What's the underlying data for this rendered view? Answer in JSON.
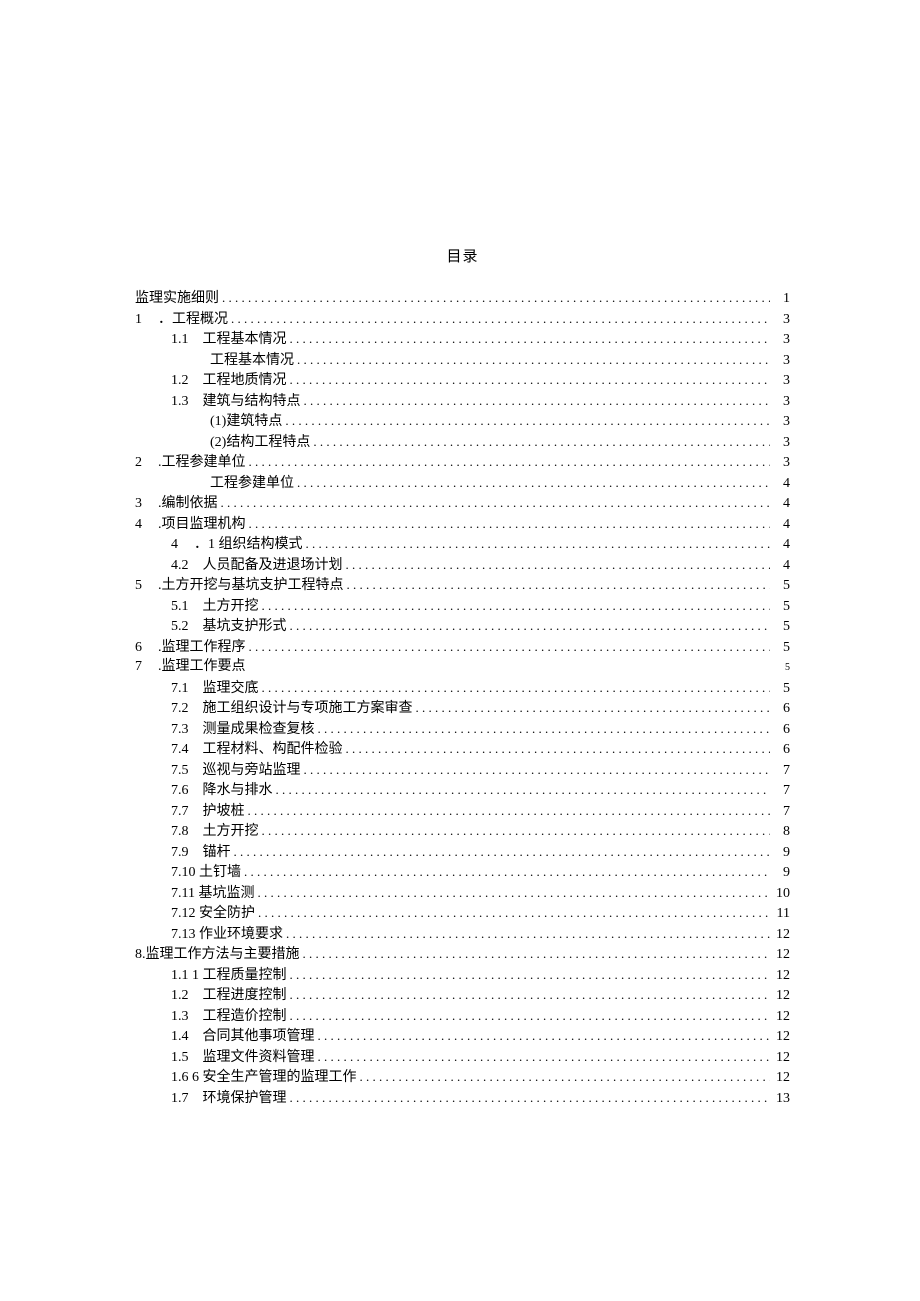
{
  "title": "目录",
  "entries": [
    {
      "indent": "indent-0",
      "num": "",
      "label": "监理实施细则",
      "gap": "",
      "page": "1",
      "pageSmall": false,
      "dots": true
    },
    {
      "indent": "indent-top",
      "num": "1",
      "label": "．工程概况",
      "gap": "gap-1",
      "page": "3",
      "pageSmall": false,
      "dots": true
    },
    {
      "indent": "indent-sec",
      "num": "1.1",
      "label": "工程基本情况",
      "gap": "gap-2",
      "page": "3",
      "pageSmall": false,
      "dots": true
    },
    {
      "indent": "indent-sub",
      "num": "",
      "label": "工程基本情况",
      "gap": "",
      "page": "3",
      "pageSmall": false,
      "dots": true
    },
    {
      "indent": "indent-sec",
      "num": "1.2",
      "label": "工程地质情况",
      "gap": "gap-2",
      "page": "3",
      "pageSmall": false,
      "dots": true
    },
    {
      "indent": "indent-sec",
      "num": "1.3",
      "label": "建筑与结构特点",
      "gap": "gap-2",
      "page": "3",
      "pageSmall": false,
      "dots": true
    },
    {
      "indent": "indent-sub",
      "num": "",
      "label": "(1)建筑特点",
      "gap": "",
      "page": "3",
      "pageSmall": false,
      "dots": true
    },
    {
      "indent": "indent-sub",
      "num": "",
      "label": "(2)结构工程特点",
      "gap": "",
      "page": "3",
      "pageSmall": false,
      "dots": true
    },
    {
      "indent": "indent-top",
      "num": "2",
      "label": ".工程参建单位",
      "gap": "gap-1",
      "page": "3",
      "pageSmall": false,
      "dots": true
    },
    {
      "indent": "indent-sub",
      "num": "",
      "label": "工程参建单位",
      "gap": "",
      "page": "4",
      "pageSmall": false,
      "dots": true
    },
    {
      "indent": "indent-top",
      "num": "3",
      "label": ".编制依据",
      "gap": "gap-1",
      "page": "4",
      "pageSmall": false,
      "dots": true
    },
    {
      "indent": "indent-top",
      "num": "4",
      "label": ".项目监理机构",
      "gap": "gap-1",
      "page": "4",
      "pageSmall": false,
      "dots": true
    },
    {
      "indent": "indent-sec",
      "num": "4",
      "label": "．1 组织结构模式",
      "gap": "gap-1",
      "page": "4",
      "pageSmall": false,
      "dots": true
    },
    {
      "indent": "indent-sec",
      "num": "4.2",
      "label": "人员配备及进退场计划",
      "gap": "gap-2",
      "page": "4",
      "pageSmall": false,
      "dots": true
    },
    {
      "indent": "indent-top",
      "num": "5",
      "label": ".土方开挖与基坑支护工程特点",
      "gap": "gap-1",
      "page": "5",
      "pageSmall": false,
      "dots": true
    },
    {
      "indent": "indent-sec",
      "num": "5.1",
      "label": "土方开挖",
      "gap": "gap-2",
      "page": "5",
      "pageSmall": false,
      "dots": true
    },
    {
      "indent": "indent-sec",
      "num": "5.2",
      "label": "基坑支护形式",
      "gap": "gap-2",
      "page": "5",
      "pageSmall": false,
      "dots": true
    },
    {
      "indent": "indent-top",
      "num": "6",
      "label": ".监理工作程序",
      "gap": "gap-1",
      "page": "5",
      "pageSmall": false,
      "dots": true
    },
    {
      "indent": "indent-top",
      "num": "7",
      "label": ".监理工作要点",
      "gap": "gap-1",
      "page": "5",
      "pageSmall": true,
      "dots": false
    },
    {
      "indent": "indent-sec",
      "num": "7.1",
      "label": "监理交底",
      "gap": "gap-2",
      "page": "5",
      "pageSmall": false,
      "dots": true
    },
    {
      "indent": "indent-sec",
      "num": "7.2",
      "label": "施工组织设计与专项施工方案审查",
      "gap": "gap-2",
      "page": "6",
      "pageSmall": false,
      "dots": true
    },
    {
      "indent": "indent-sec",
      "num": "7.3",
      "label": "测量成果检查复核",
      "gap": "gap-2",
      "page": "6",
      "pageSmall": false,
      "dots": true
    },
    {
      "indent": "indent-sec",
      "num": "7.4",
      "label": "工程材料、构配件检验",
      "gap": "gap-2",
      "page": "6",
      "pageSmall": false,
      "dots": true
    },
    {
      "indent": "indent-sec",
      "num": "7.5",
      "label": "巡视与旁站监理",
      "gap": "gap-2",
      "page": "7",
      "pageSmall": false,
      "dots": true
    },
    {
      "indent": "indent-sec",
      "num": "7.6",
      "label": "降水与排水",
      "gap": "gap-2",
      "page": "7",
      "pageSmall": false,
      "dots": true
    },
    {
      "indent": "indent-sec",
      "num": "7.7",
      "label": "护坡桩",
      "gap": "gap-2",
      "page": "7",
      "pageSmall": false,
      "dots": true
    },
    {
      "indent": "indent-sec",
      "num": "7.8",
      "label": "土方开挖",
      "gap": "gap-2",
      "page": "8",
      "pageSmall": false,
      "dots": true
    },
    {
      "indent": "indent-sec",
      "num": "7.9",
      "label": "锚杆",
      "gap": "gap-2",
      "page": "9",
      "pageSmall": false,
      "dots": true
    },
    {
      "indent": "indent-sec",
      "num": "",
      "label": "7.10 土钉墙",
      "gap": "",
      "page": "9",
      "pageSmall": false,
      "dots": true
    },
    {
      "indent": "indent-sec",
      "num": "",
      "label": "7.11 基坑监测",
      "gap": "",
      "page": "10",
      "pageSmall": false,
      "dots": true
    },
    {
      "indent": "indent-sec",
      "num": "",
      "label": "7.12 安全防护",
      "gap": "",
      "page": "11",
      "pageSmall": false,
      "dots": true
    },
    {
      "indent": "indent-sec",
      "num": "",
      "label": "7.13 作业环境要求",
      "gap": "",
      "page": "12",
      "pageSmall": false,
      "dots": true
    },
    {
      "indent": "indent-0",
      "num": "",
      "label": "8.监理工作方法与主要措施",
      "gap": "",
      "page": "12",
      "pageSmall": false,
      "dots": true
    },
    {
      "indent": "indent-sec",
      "num": "",
      "label": "1.1 1 工程质量控制",
      "gap": "",
      "page": "12",
      "pageSmall": false,
      "dots": true
    },
    {
      "indent": "indent-sec",
      "num": "1.2",
      "label": "工程进度控制",
      "gap": "gap-2",
      "page": "12",
      "pageSmall": false,
      "dots": true
    },
    {
      "indent": "indent-sec",
      "num": "1.3",
      "label": "工程造价控制",
      "gap": "gap-2",
      "page": "12",
      "pageSmall": false,
      "dots": true
    },
    {
      "indent": "indent-sec",
      "num": "1.4",
      "label": "合同其他事项管理",
      "gap": "gap-2",
      "page": "12",
      "pageSmall": false,
      "dots": true
    },
    {
      "indent": "indent-sec",
      "num": "1.5",
      "label": "监理文件资料管理",
      "gap": "gap-2",
      "page": "12",
      "pageSmall": false,
      "dots": true
    },
    {
      "indent": "indent-sec",
      "num": "",
      "label": "1.6 6 安全生产管理的监理工作",
      "gap": "",
      "page": "12",
      "pageSmall": false,
      "dots": true
    },
    {
      "indent": "indent-sec",
      "num": "1.7",
      "label": "环境保护管理",
      "gap": "gap-2",
      "page": "13",
      "pageSmall": false,
      "dots": true
    }
  ]
}
